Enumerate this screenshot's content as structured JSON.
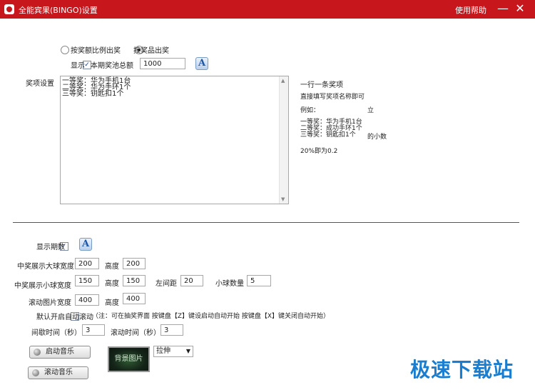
{
  "window": {
    "title": "全能宾果(BINGO)设置",
    "help": "使用帮助",
    "minimize": "—",
    "close": "✕"
  },
  "award_mode": {
    "option1": "按奖额比例出奖",
    "option2": "按奖品出奖",
    "selected": "option2"
  },
  "display": {
    "label": "显示",
    "checked": true,
    "pool_label": "本期奖池总额",
    "pool_value": "1000",
    "font_button": "A"
  },
  "prize_settings": {
    "label": "奖项设置",
    "content": "一等奖：华为手机1台\n二等奖：华为手环1个\n三等奖：钥匙扣1个"
  },
  "hints": {
    "line1": "一行一条奖项",
    "line2": "直接填写奖项名称即可",
    "line3a": "例如：",
    "line3b": "立",
    "example": "一等奖：华为手机1台\n二等奖：成功手环1个\n三等奖：钥匙扣1个",
    "example_tail": "的小数",
    "line5": "20%即为0.2"
  },
  "show_period": {
    "label": "显示期数",
    "checked": true,
    "font_button": "A"
  },
  "big_ball": {
    "label": "中奖展示大球宽度",
    "width": "200",
    "height_label": "高度",
    "height": "200"
  },
  "small_ball": {
    "label": "中奖展示小球宽度",
    "width": "150",
    "height_label": "高度",
    "height": "150",
    "left_margin_label": "左间距",
    "left_margin": "20",
    "count_label": "小球数量",
    "count": "5"
  },
  "scroll_image": {
    "label": "滚动图片宽度",
    "width": "400",
    "height_label": "高度",
    "height": "400"
  },
  "auto_scroll": {
    "label": "默认开启自动滚动",
    "checked": false,
    "note": "（注：可在抽奖界面  按键盘【Z】键设启动自动开始      按键盘【X】键关闭自动开始）"
  },
  "timing": {
    "interval_label": "间歇时间（秒）",
    "interval": "3",
    "scroll_label": "滚动时间（秒）",
    "scroll": "3"
  },
  "buttons": {
    "start_music": "启动音乐",
    "scroll_music": "滚动音乐",
    "background_image": "背景图片"
  },
  "stretch_select": {
    "value": "拉伸"
  },
  "watermark": "极速下载站"
}
